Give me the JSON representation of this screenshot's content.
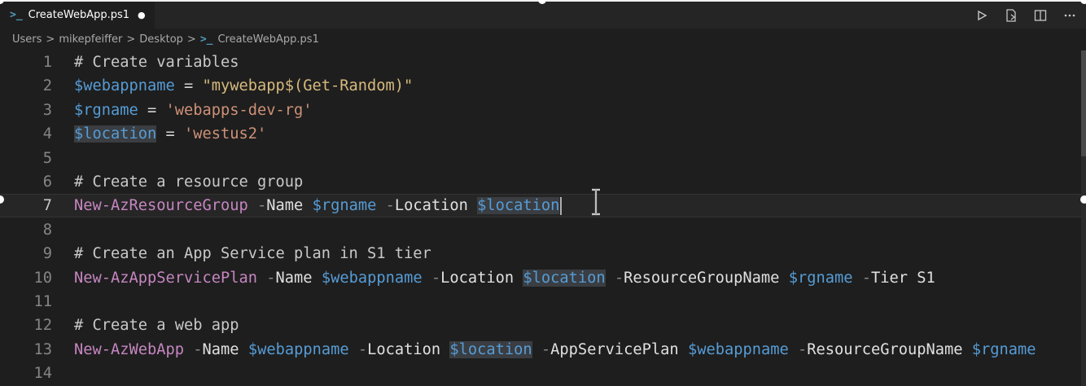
{
  "tab": {
    "label": "CreateWebApp.ps1",
    "dirty_marker": "●",
    "icon": "powershell-icon"
  },
  "breadcrumb": {
    "items": [
      "Users",
      "mikepfeiffer",
      "Desktop",
      "CreateWebApp.ps1"
    ],
    "separator": ">"
  },
  "actions": [
    {
      "name": "run-icon"
    },
    {
      "name": "open-changes-icon"
    },
    {
      "name": "split-editor-icon"
    },
    {
      "name": "more-actions-icon"
    }
  ],
  "editor": {
    "active_line": 7,
    "lines": [
      {
        "n": "1",
        "tokens": [
          [
            "cmt",
            "# Create variables"
          ]
        ]
      },
      {
        "n": "2",
        "tokens": [
          [
            "var",
            "$webappname"
          ],
          [
            "op",
            " = "
          ],
          [
            "strdq",
            "\"mywebapp$(Get-Random)\""
          ]
        ]
      },
      {
        "n": "3",
        "tokens": [
          [
            "var",
            "$rgname"
          ],
          [
            "op",
            " = "
          ],
          [
            "str",
            "'webapps-dev-rg'"
          ]
        ]
      },
      {
        "n": "4",
        "tokens": [
          [
            "varhl",
            "$location"
          ],
          [
            "op",
            " = "
          ],
          [
            "str",
            "'westus2'"
          ]
        ]
      },
      {
        "n": "5",
        "tokens": []
      },
      {
        "n": "6",
        "tokens": [
          [
            "cmt",
            "# Create a resource group"
          ]
        ]
      },
      {
        "n": "7",
        "tokens": [
          [
            "cmd",
            "New-AzResourceGroup"
          ],
          [
            "dash",
            " -"
          ],
          [
            "param",
            "Name"
          ],
          [
            "op",
            " "
          ],
          [
            "var",
            "$rgname"
          ],
          [
            "dash",
            " -"
          ],
          [
            "param",
            "Location"
          ],
          [
            "op",
            " "
          ],
          [
            "varhl",
            "$location"
          ]
        ]
      },
      {
        "n": "8",
        "tokens": []
      },
      {
        "n": "9",
        "tokens": [
          [
            "cmt",
            "# Create an App Service plan in S1 tier"
          ]
        ]
      },
      {
        "n": "10",
        "tokens": [
          [
            "cmd",
            "New-AzAppServicePlan"
          ],
          [
            "dash",
            " -"
          ],
          [
            "param",
            "Name"
          ],
          [
            "op",
            " "
          ],
          [
            "var",
            "$webappname"
          ],
          [
            "dash",
            " -"
          ],
          [
            "param",
            "Location"
          ],
          [
            "op",
            " "
          ],
          [
            "varhl",
            "$location"
          ],
          [
            "dash",
            " -"
          ],
          [
            "param",
            "ResourceGroupName"
          ],
          [
            "op",
            " "
          ],
          [
            "var",
            "$rgname"
          ],
          [
            "dash",
            " -"
          ],
          [
            "param",
            "Tier S1"
          ]
        ]
      },
      {
        "n": "11",
        "tokens": []
      },
      {
        "n": "12",
        "tokens": [
          [
            "cmt",
            "# Create a web app"
          ]
        ]
      },
      {
        "n": "13",
        "tokens": [
          [
            "cmd",
            "New-AzWebApp"
          ],
          [
            "dash",
            " -"
          ],
          [
            "param",
            "Name"
          ],
          [
            "op",
            " "
          ],
          [
            "var",
            "$webappname"
          ],
          [
            "dash",
            " -"
          ],
          [
            "param",
            "Location"
          ],
          [
            "op",
            " "
          ],
          [
            "varhl",
            "$location"
          ],
          [
            "dash",
            " -"
          ],
          [
            "param",
            "AppServicePlan"
          ],
          [
            "op",
            " "
          ],
          [
            "var",
            "$webappname"
          ],
          [
            "dash",
            " -"
          ],
          [
            "param",
            "ResourceGroupName"
          ],
          [
            "op",
            " "
          ],
          [
            "var",
            "$rgname"
          ]
        ]
      },
      {
        "n": "14",
        "tokens": []
      }
    ]
  },
  "colors": {
    "background": "#1e1e1e",
    "comment": "#c8c8c8",
    "variable": "#569cd6",
    "string": "#ce9178",
    "command": "#c586c0",
    "highlight": "#3a3d41"
  }
}
